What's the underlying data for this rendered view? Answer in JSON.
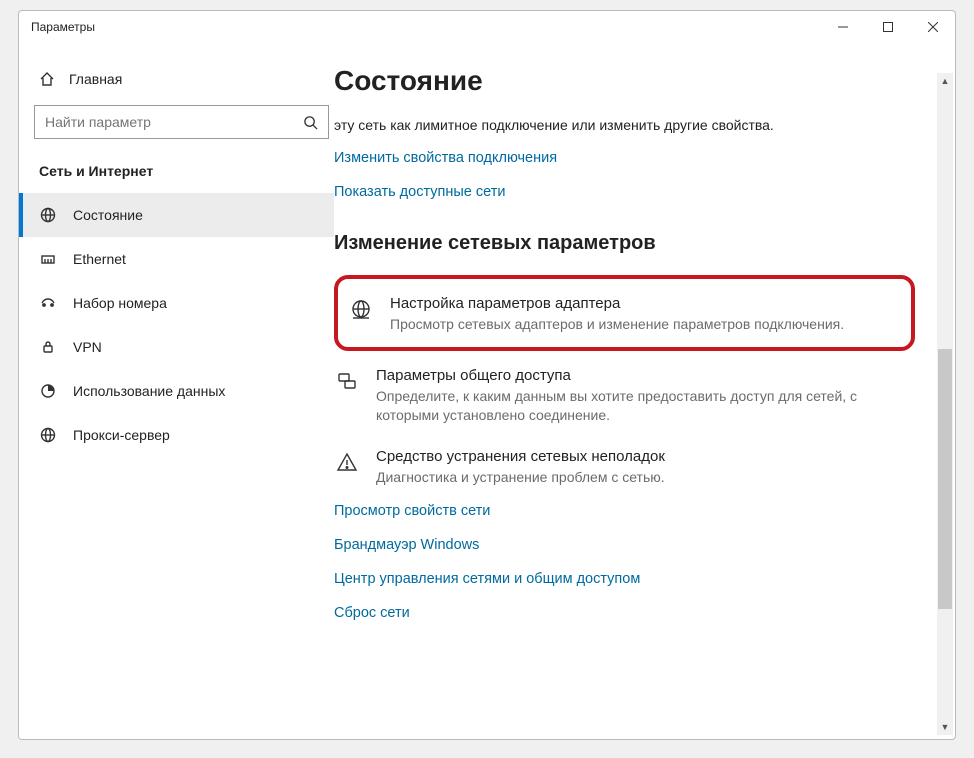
{
  "window": {
    "title": "Параметры"
  },
  "sidebar": {
    "home": "Главная",
    "search_placeholder": "Найти параметр",
    "section": "Сеть и Интернет",
    "items": [
      {
        "label": "Состояние",
        "active": true
      },
      {
        "label": "Ethernet",
        "active": false
      },
      {
        "label": "Набор номера",
        "active": false
      },
      {
        "label": "VPN",
        "active": false
      },
      {
        "label": "Использование данных",
        "active": false
      },
      {
        "label": "Прокси-сервер",
        "active": false
      }
    ]
  },
  "content": {
    "page_title": "Состояние",
    "intro_text": "эту сеть как лимитное подключение или изменить другие свойства.",
    "link_change_conn": "Изменить свойства подключения",
    "link_show_nets": "Показать доступные сети",
    "subheading": "Изменение сетевых параметров",
    "options": [
      {
        "title": "Настройка параметров адаптера",
        "desc": "Просмотр сетевых адаптеров и изменение параметров подключения.",
        "highlighted": true
      },
      {
        "title": "Параметры общего доступа",
        "desc": "Определите, к каким данным вы хотите предоставить доступ для сетей, с которыми установлено соединение."
      },
      {
        "title": "Средство устранения сетевых неполадок",
        "desc": "Диагностика и устранение проблем с сетью."
      }
    ],
    "links_bottom": [
      "Просмотр свойств сети",
      "Брандмауэр Windows",
      "Центр управления сетями и общим доступом",
      "Сброс сети"
    ]
  }
}
